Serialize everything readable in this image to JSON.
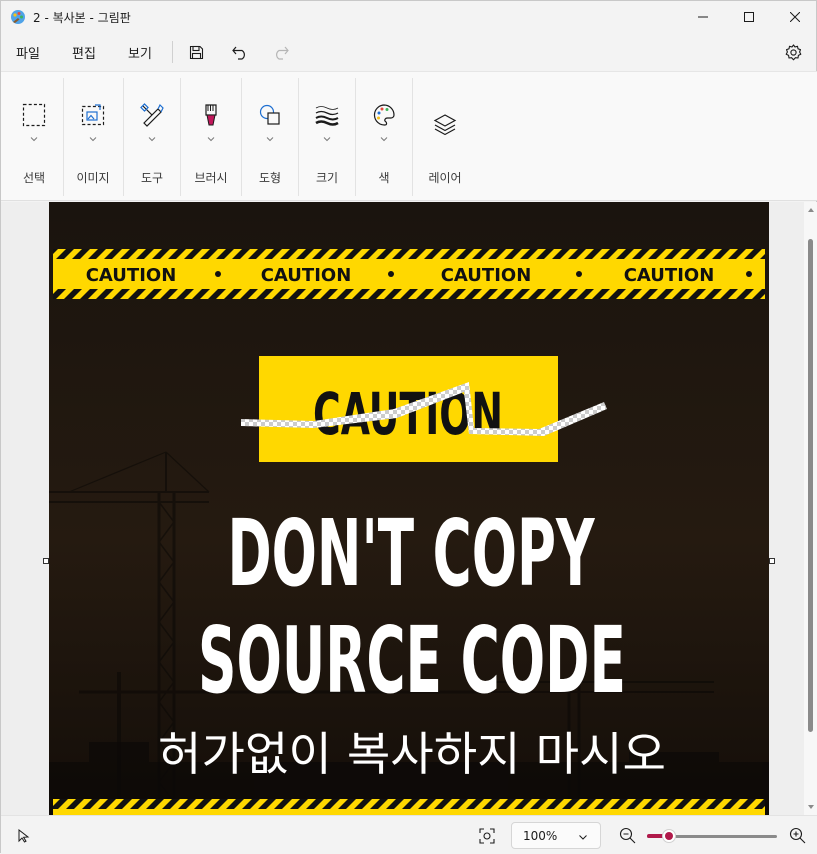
{
  "window": {
    "title": "2 - 복사본 - 그림판",
    "minimize_icon": "minimize-icon",
    "maximize_icon": "maximize-icon",
    "close_icon": "close-icon"
  },
  "menu": {
    "items": [
      "파일",
      "편집",
      "보기"
    ],
    "icons": [
      "save-icon",
      "undo-icon",
      "redo-icon",
      "settings-icon"
    ]
  },
  "ribbon": {
    "groups": [
      {
        "label": "선택",
        "icon": "selection-icon"
      },
      {
        "label": "이미지",
        "icon": "image-icon"
      },
      {
        "label": "도구",
        "icon": "tools-icon"
      },
      {
        "label": "브러시",
        "icon": "brush-icon"
      },
      {
        "label": "도형",
        "icon": "shapes-icon"
      },
      {
        "label": "크기",
        "icon": "size-icon"
      },
      {
        "label": "색",
        "icon": "palette-icon"
      },
      {
        "label": "레이어",
        "icon": "layers-icon"
      }
    ]
  },
  "canvas_image": {
    "tape_word": "CAUTION",
    "tape_items": [
      "CAUTION",
      "CAUTION",
      "CAUTION",
      "CAUTION"
    ],
    "sign_text": "CAUTION",
    "headline_line1": "DON'T COPY",
    "headline_line2": "SOURCE CODE",
    "korean_text": "허가없이 복사하지 마시오",
    "colors": {
      "yellow": "#ffd800",
      "dark": "#1a140e",
      "black": "#111111",
      "white": "#ffffff"
    }
  },
  "status": {
    "pointer_icon": "pointer-icon",
    "fit_icon": "fit-to-window-icon",
    "zoom_value": "100%",
    "zoom_out_icon": "zoom-out-icon",
    "zoom_in_icon": "zoom-in-icon",
    "zoom_slider_level": 0.15,
    "accent_color": "#b0194a"
  }
}
